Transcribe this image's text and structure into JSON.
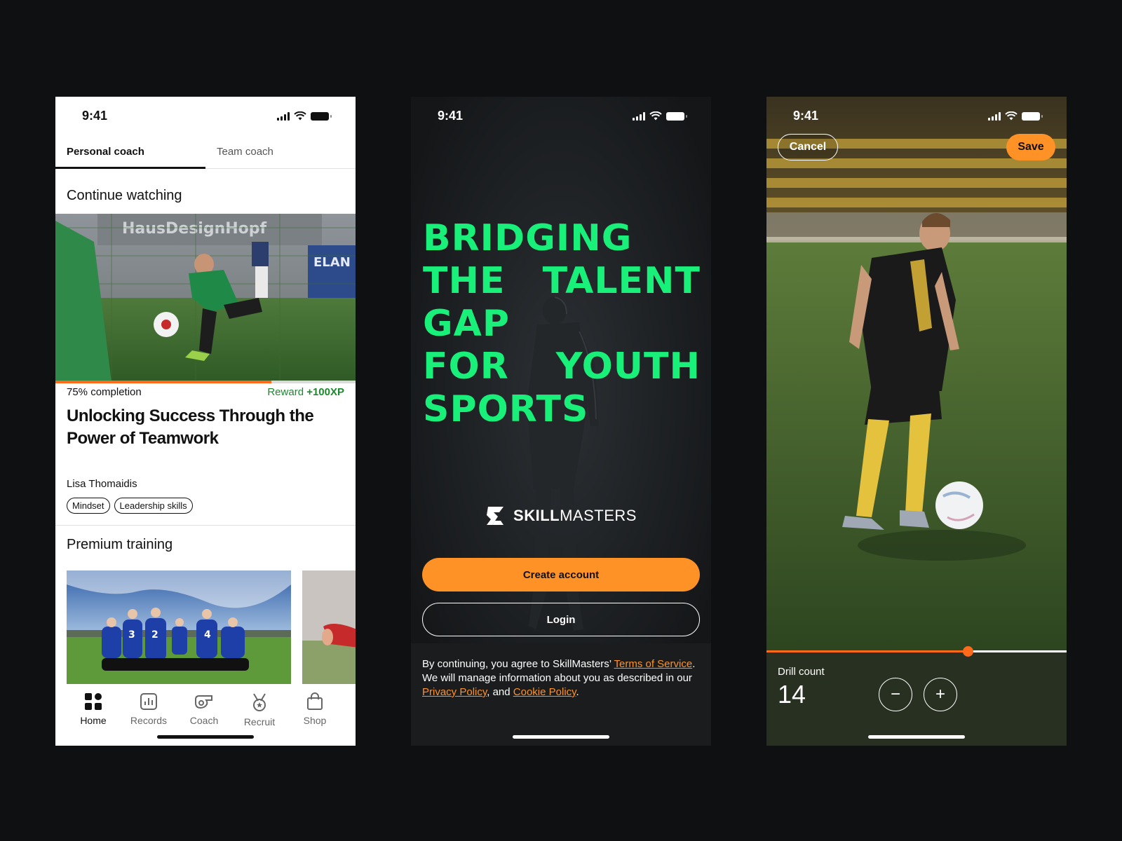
{
  "status_time": "9:41",
  "screen1": {
    "tabs": [
      "Personal coach",
      "Team coach"
    ],
    "continue_watching": "Continue watching",
    "progress": 0.72,
    "completion": "75% completion",
    "reward_label": "Reward",
    "reward_value": "+100XP",
    "course_title": "Unlocking Success Through the Power of Teamwork",
    "author": "Lisa Thomaidis",
    "tags": [
      "Mindset",
      "Leadership skills"
    ],
    "premium_training": "Premium training",
    "banner_text_1": "HausDesignHopf",
    "banner_text_2": "ELAN",
    "nav": [
      {
        "label": "Home",
        "icon": "home-icon",
        "active": true
      },
      {
        "label": "Records",
        "icon": "records-icon",
        "active": false
      },
      {
        "label": "Coach",
        "icon": "whistle-icon",
        "active": false
      },
      {
        "label": "Recruit",
        "icon": "medal-icon",
        "active": false
      },
      {
        "label": "Shop",
        "icon": "shopping-bag-icon",
        "active": false
      }
    ]
  },
  "screen2": {
    "headline_lines": [
      [
        "BRIDGING"
      ],
      [
        "THE",
        "TALENT"
      ],
      [
        "GAP"
      ],
      [
        "FOR",
        "YOUTH"
      ],
      [
        "SPORTS"
      ]
    ],
    "brand_bold": "SKILL",
    "brand_light": "MASTERS",
    "create_account": "Create account",
    "login": "Login",
    "legal_1": "By continuing, you agree to SkillMasters’ ",
    "legal_terms": "Terms of Service",
    "legal_2": ". We will manage information about you as described in our ",
    "legal_privacy": "Privacy Policy",
    "legal_3": ", and ",
    "legal_cookie": "Cookie Policy",
    "legal_4": ".",
    "accent_color": "#19f07a",
    "button_color": "#ff9227"
  },
  "screen3": {
    "cancel": "Cancel",
    "save": "Save",
    "drill_label": "Drill count",
    "drill_value": "14",
    "minus": "−",
    "plus": "+",
    "scrub_position": 0.67
  }
}
